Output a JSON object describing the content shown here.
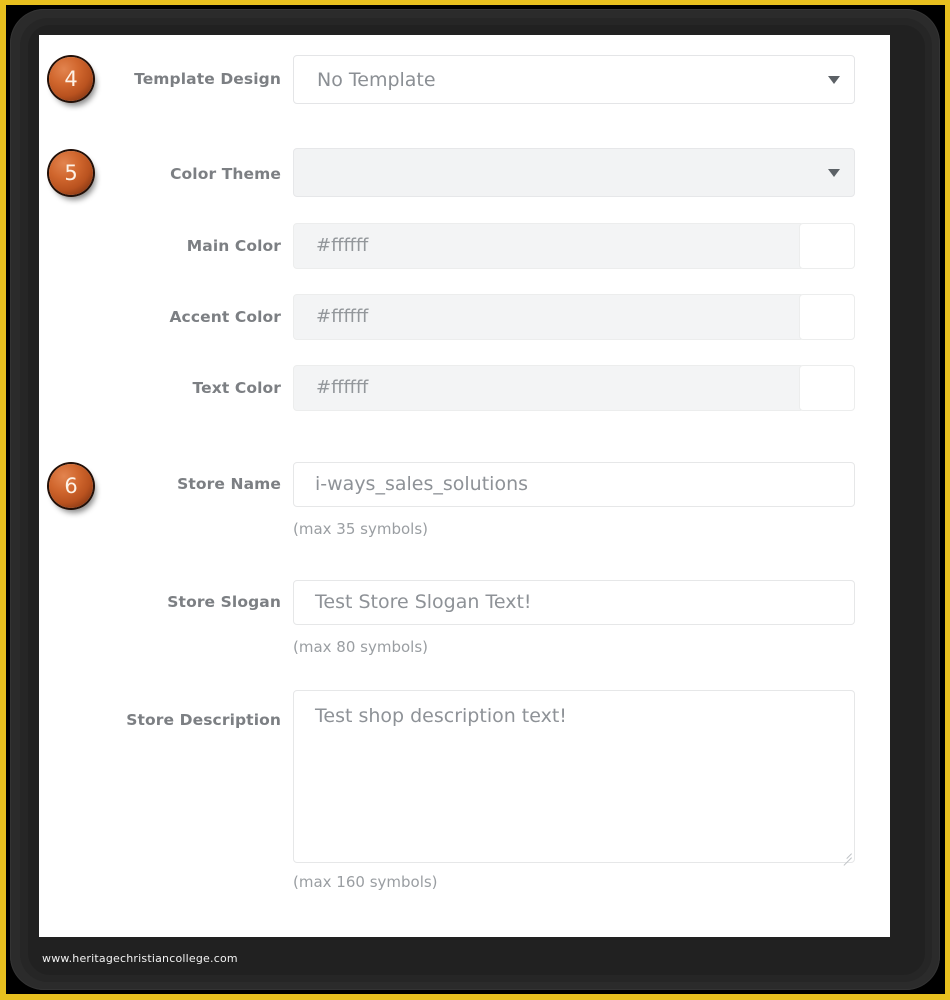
{
  "theme": {
    "frame_color": "#e8c01f",
    "bezel_color": "#2b2b2b",
    "badge_color": "#d1672e",
    "label_color": "#7c7f83",
    "panel_background": "#ffffff"
  },
  "form": {
    "rows": [
      {
        "badge": "4",
        "label": "Template Design",
        "control": "select",
        "value": "No Template",
        "disabled": false,
        "hint": ""
      },
      {
        "badge": "5",
        "label": "Color Theme",
        "control": "select",
        "value": "",
        "disabled": true,
        "hint": ""
      },
      {
        "badge": "",
        "label": "Main Color",
        "control": "color",
        "value": "#ffffff",
        "swatch": "#ffffff",
        "hint": ""
      },
      {
        "badge": "",
        "label": "Accent Color",
        "control": "color",
        "value": "#ffffff",
        "swatch": "#ffffff",
        "hint": ""
      },
      {
        "badge": "",
        "label": "Text Color",
        "control": "color",
        "value": "#ffffff",
        "swatch": "#ffffff",
        "hint": ""
      },
      {
        "badge": "6",
        "label": "Store Name",
        "control": "text",
        "value": "i-ways_sales_solutions",
        "hint": "(max 35 symbols)"
      },
      {
        "badge": "",
        "label": "Store Slogan",
        "control": "text",
        "value": "Test Store Slogan Text!",
        "hint": "(max 80 symbols)"
      },
      {
        "badge": "",
        "label": "Store Description",
        "control": "textarea",
        "value": "Test shop description text!",
        "hint": "(max 160 symbols)"
      }
    ]
  },
  "icons": {
    "caret": "chevron-down-icon",
    "resize": "resize-handle-icon"
  },
  "watermark": {
    "text": "www.heritagechristiancollege.com"
  }
}
